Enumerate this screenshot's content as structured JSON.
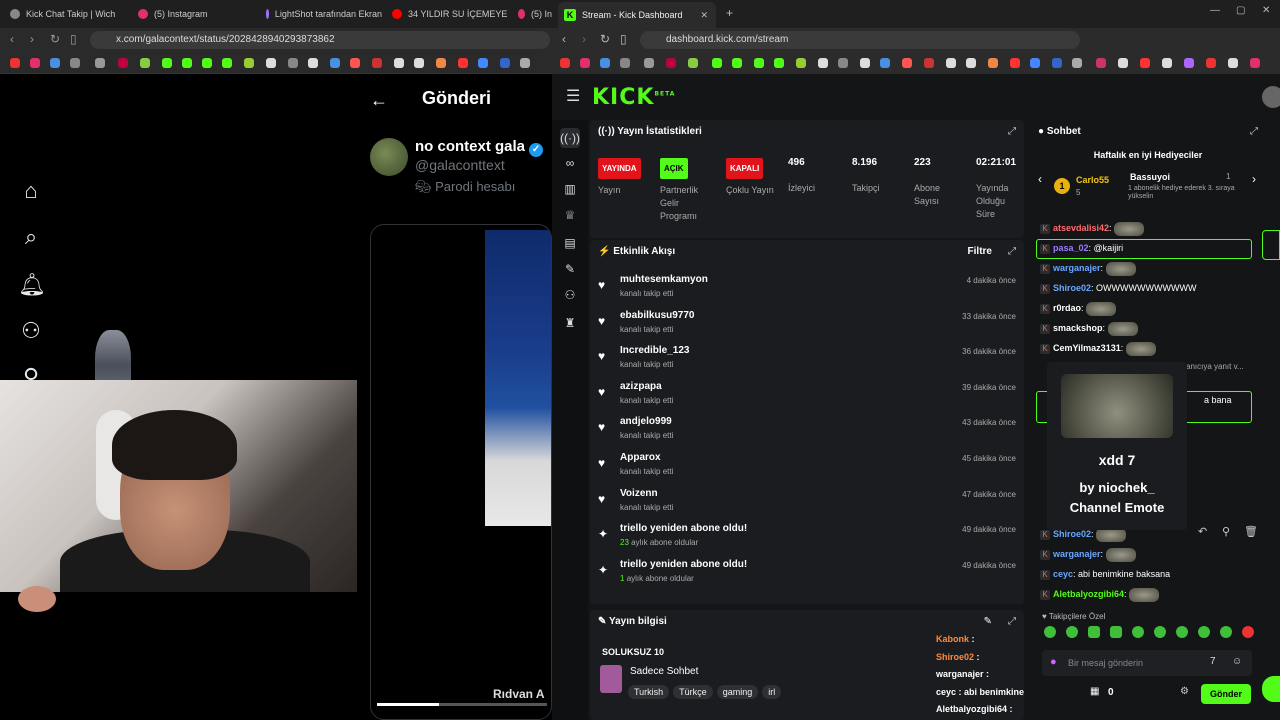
{
  "left_browser": {
    "tabs": [
      {
        "label": "Kick Chat Takip | Wich",
        "color": "#888"
      },
      {
        "label": "(5) Instagram",
        "color": "#e1306c"
      },
      {
        "label": "LightShot tarafından Ekran",
        "color": "#a070ff"
      },
      {
        "label": "34 YILDIR SU İÇEMEYE",
        "color": "#ff0000"
      },
      {
        "label": "(5) In",
        "color": "#e1306c"
      }
    ],
    "url": "x.com/galacontext/status/2028428940293873862"
  },
  "x_post": {
    "header_title": "Gönderi",
    "author_name": "no context gala",
    "handle": "@galaconttext",
    "parody_label": "Parodi hesabı",
    "video_caption": "Rıdvan A"
  },
  "right_browser": {
    "tab_label": "Stream - Kick Dashboard",
    "url": "dashboard.kick.com/stream"
  },
  "kick": {
    "logo": "KICK",
    "logo_beta": "BETA",
    "stats_panel": {
      "title": "Yayın İstatistikleri",
      "items": [
        {
          "badge": "YAYINDA",
          "label": "Yayın"
        },
        {
          "badge": "AÇIK",
          "label": "Partnerlik Gelir Programı"
        },
        {
          "badge": "KAPALI",
          "label": "Çoklu Yayın"
        },
        {
          "value": "496",
          "label": "İzleyici"
        },
        {
          "value": "8.196",
          "label": "Takipçi"
        },
        {
          "value": "223",
          "label": "Abone Sayısı"
        },
        {
          "value": "02:21:01",
          "label": "Yayında Olduğu Süre"
        }
      ]
    },
    "activity": {
      "title": "Etkinlik Akışı",
      "filter_label": "Filtre",
      "events": [
        {
          "name": "muhtesemkamyon",
          "sub": "kanalı takip etti",
          "time": "4 dakika önce",
          "icon": "heart"
        },
        {
          "name": "ebabilkusu9770",
          "sub": "kanalı takip etti",
          "time": "33 dakika önce",
          "icon": "heart"
        },
        {
          "name": "Incredible_123",
          "sub": "kanalı takip etti",
          "time": "36 dakika önce",
          "icon": "heart"
        },
        {
          "name": "azizpapa",
          "sub": "kanalı takip etti",
          "time": "39 dakika önce",
          "icon": "heart"
        },
        {
          "name": "andjelo999",
          "sub": "kanalı takip etti",
          "time": "43 dakika önce",
          "icon": "heart"
        },
        {
          "name": "Apparox",
          "sub": "kanalı takip etti",
          "time": "45 dakika önce",
          "icon": "heart"
        },
        {
          "name": "Voizenn",
          "sub": "kanalı takip etti",
          "time": "47 dakika önce",
          "icon": "heart"
        },
        {
          "name": "triello yeniden abone oldu!",
          "sub_green": "23",
          "sub": "aylık abone oldular",
          "time": "49 dakika önce",
          "icon": "sparkle"
        },
        {
          "name": "triello yeniden abone oldu!",
          "sub_green": "1",
          "sub": "aylık abone oldular",
          "time": "49 dakika önce",
          "icon": "sparkle"
        }
      ]
    },
    "stream_info": {
      "title": "Yayın bilgisi",
      "stream_title": "SOLUKSUZ 10",
      "category": "Sadece Sohbet",
      "tags": [
        "Turkish",
        "Türkçe",
        "gaming",
        "irl"
      ]
    },
    "chat": {
      "title": "Sohbet",
      "gifters_title": "Haftalık en iyi Hediyeciler",
      "gifter1_name": "Carlo55",
      "gifter1_count": "5",
      "gifter1_rank": "1",
      "gifter2_name": "Bassuyoi",
      "gifter2_count": "1",
      "gifter2_note": "1 abonelik hediye ederek 3. sıraya yükselin",
      "messages": [
        {
          "user": "atsevdalisi42",
          "text": "",
          "color": "#ff6b6b"
        },
        {
          "user": "pasa_02",
          "text": "@kaijiri",
          "color": "#9b7bff"
        },
        {
          "user": "warganajer",
          "text": "",
          "color": "#6aa6ff"
        },
        {
          "user": "Shiroe02",
          "text": "OWWWWWWWWWWW",
          "color": "#6aa6ff"
        },
        {
          "user": "r0rdao",
          "text": "",
          "color": "#ffffff"
        },
        {
          "user": "smackshop",
          "text": "",
          "color": "#ffffff"
        },
        {
          "user": "CemYilmaz3131",
          "text": "",
          "color": "#ffffff"
        },
        {
          "user": "Shiroe02",
          "text": "",
          "color": "#6aa6ff"
        },
        {
          "user": "warganajer",
          "text": "",
          "color": "#6aa6ff"
        },
        {
          "user": "ceyc",
          "text": "abi benimkine baksana",
          "color": "#6aa6ff"
        },
        {
          "user": "Aletbalyozgibi64",
          "text": "",
          "color": "#53fc18"
        }
      ],
      "partial_reply": "anıcıya yanıt v...",
      "partial_msg": "a bana",
      "emote_popup": {
        "name": "xdd",
        "by": "by niochek_",
        "kind": "Channel Emote"
      },
      "follower_label": "Takipçilere Özel",
      "input_placeholder": "Bir mesaj gönderin",
      "counter": "0",
      "send_label": "Gönder"
    },
    "overlay_chat": [
      {
        "user": "Kabonk",
        "color": "#ff8a3d"
      },
      {
        "user": "Shiroe02",
        "color": "#ff8a3d"
      },
      {
        "user": "warganajer",
        "color": "#ffffff"
      },
      {
        "user": "ceyc",
        "text": "abi benimkine baksana",
        "color": "#ffffff"
      },
      {
        "user": "Aletbalyozgibi64",
        "color": "#ffffff"
      }
    ]
  }
}
